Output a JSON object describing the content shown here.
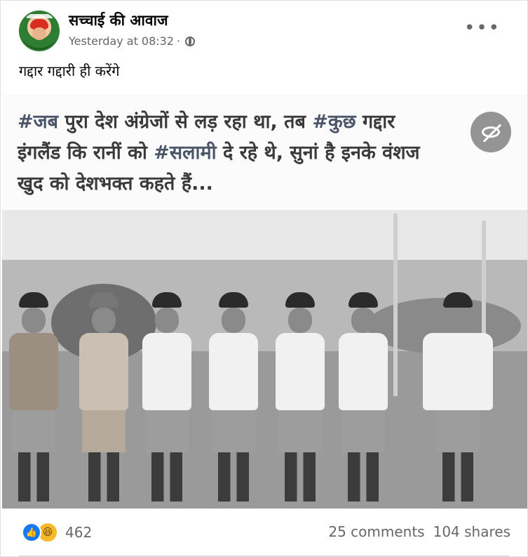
{
  "post": {
    "page_name": "सच्चाई की आवाज",
    "timestamp": "Yesterday at 08:32",
    "separator": "·",
    "privacy_icon": "globe-icon",
    "more_icon": "more-options-icon",
    "caption": "गद्दार गद्दारी ही करेंगे"
  },
  "media": {
    "text_line1_part1": "#जब",
    "text_line1_part2": " पुरा देश अंग्रेजों से लड़ रहा था, तब ",
    "text_line1_part3": "#कुछ",
    "text_line1_part4": " गद्दार",
    "text_line2_part1": "इंगलैंड कि रानीं को ",
    "text_line2_part2": "#सलामी",
    "text_line2_part3": " दे रहे थे, सुनां है इनके वंशज",
    "text_line3": "खुद को देशभक्त कहते हैं...",
    "hide_icon": "eye-slash-icon"
  },
  "footer": {
    "reaction_icons": [
      "like-icon",
      "haha-icon"
    ],
    "reaction_count": "462",
    "comments": "25 comments",
    "shares": "104 shares"
  },
  "colors": {
    "like_blue": "#1877f2",
    "haha_yellow": "#f7b928",
    "meta_gray": "#65676b"
  }
}
